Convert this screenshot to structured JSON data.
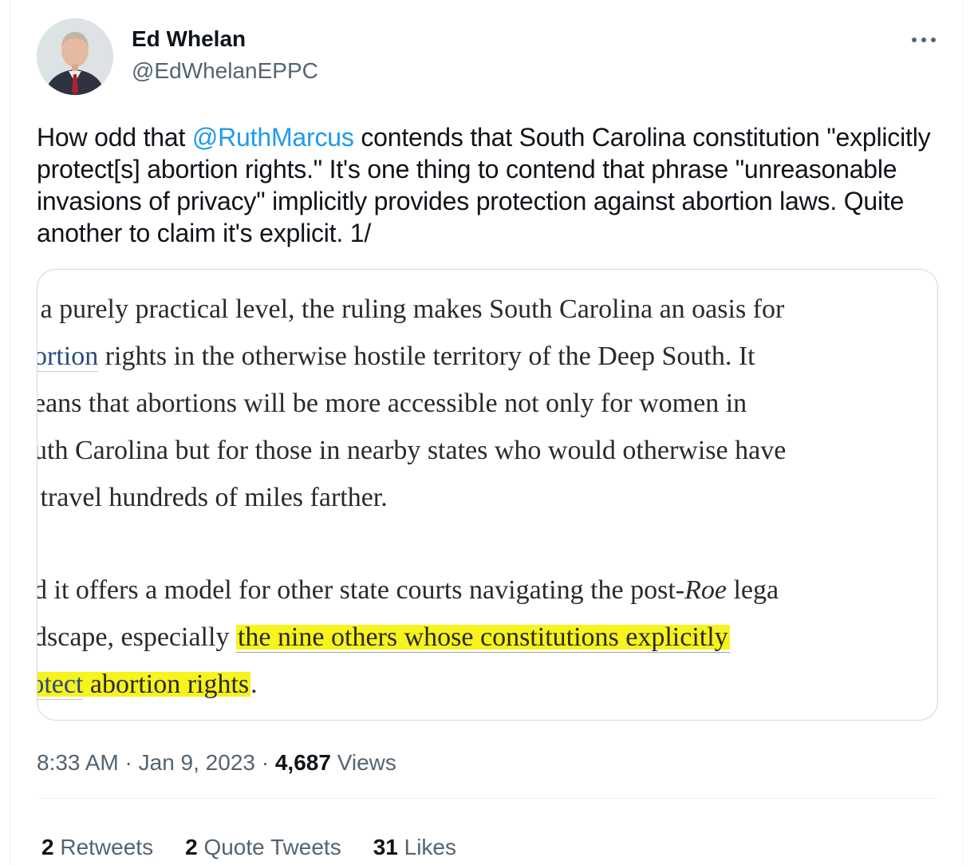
{
  "author": {
    "name": "Ed Whelan",
    "handle": "@EdWhelanEPPC"
  },
  "tweet": {
    "text_before": "How odd that ",
    "mention": "@RuthMarcus",
    "text_after": " contends that South Carolina constitution \"explicitly protect[s] abortion rights.\" It's one thing to contend that phrase \"unreasonable invasions of privacy\" implicitly provides protection against abortion laws. Quite another to claim it's explicit. 1/"
  },
  "media": {
    "p1_line1": "n a purely practical level, the ruling makes South Carolina an oasis for",
    "p1_line2_link": "bortion",
    "p1_line2_rest": " rights in the otherwise hostile territory of the Deep South. It",
    "p1_line3": "neans that abortions will be more accessible not only for women in",
    "p1_line4": "outh Carolina but for those in nearby states who would otherwise have",
    "p1_line5": "o travel hundreds of miles farther.",
    "p2_line1_before": "nd it offers a model for other state courts navigating the post-",
    "p2_line1_italic": "Roe",
    "p2_line1_after": " lega",
    "p2_line2_before": "ndscape, especially ",
    "p2_line2_hl": "the nine others whose constitutions explicitly",
    "p2_line3_hl_link": "rotect",
    "p2_line3_hl_rest": " abortion rights",
    "p2_line3_end": "."
  },
  "meta": {
    "time": "8:33 AM",
    "date": "Jan 9, 2023",
    "sep": " · ",
    "views_count": "4,687",
    "views_label": "Views"
  },
  "stats": {
    "retweets_count": "2",
    "retweets_label": "Retweets",
    "quotes_count": "2",
    "quotes_label": "Quote Tweets",
    "likes_count": "31",
    "likes_label": "Likes"
  },
  "icons": {
    "more": "more-horizontal-icon"
  },
  "colors": {
    "link": "#1d9bf0",
    "secondary_text": "#536471",
    "highlight": "#f7f31c"
  }
}
